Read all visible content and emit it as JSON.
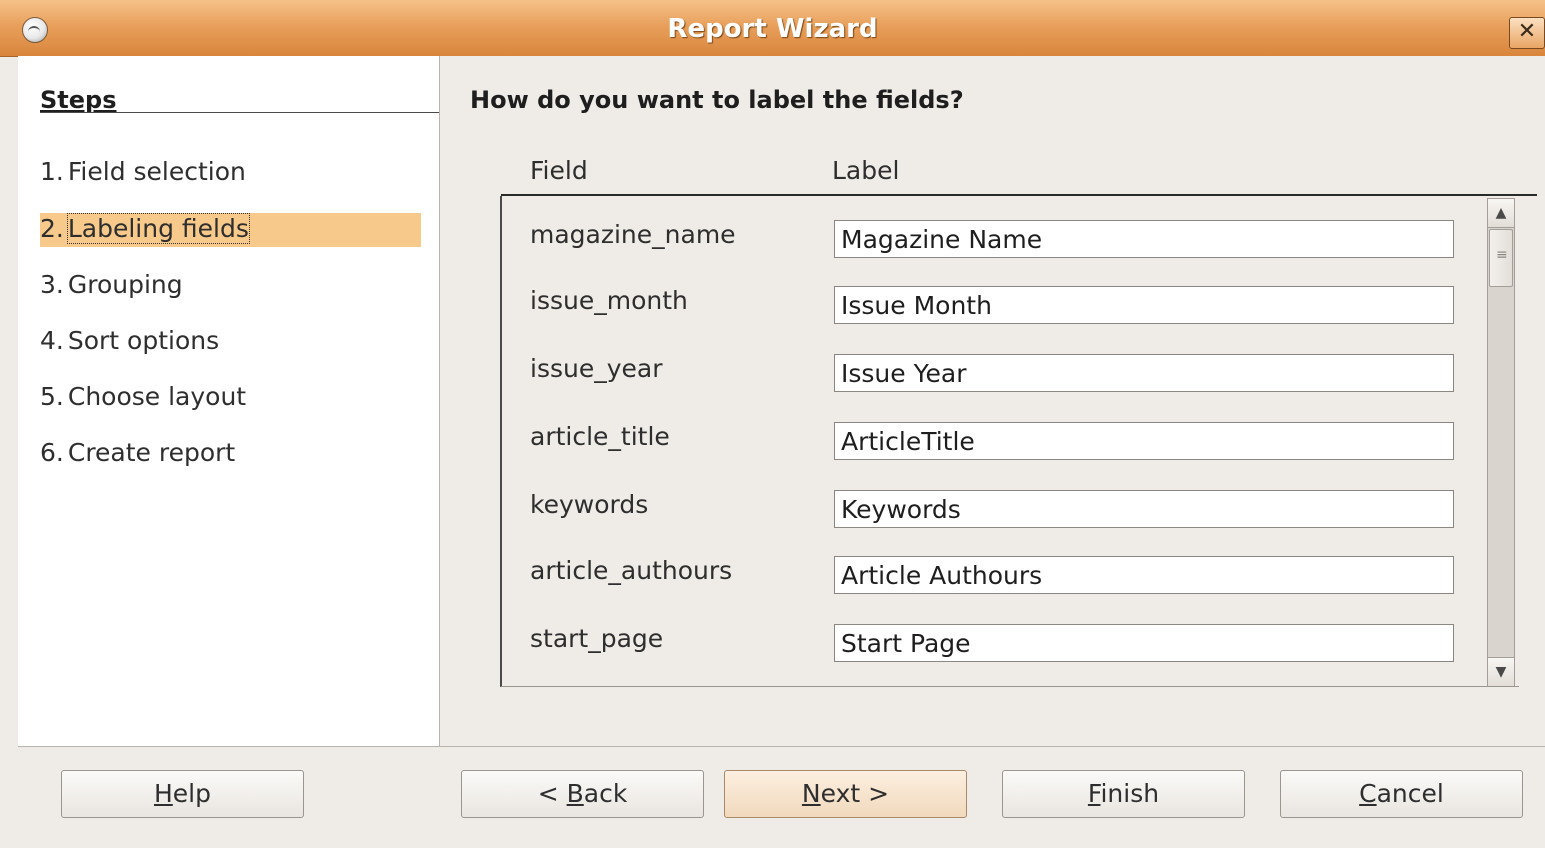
{
  "window": {
    "title": "Report Wizard",
    "close_glyph": "✕",
    "menu_icon": "window-menu-icon"
  },
  "steps": {
    "title": "Steps",
    "items": [
      {
        "num": "1.",
        "label": "Field selection",
        "selected": false
      },
      {
        "num": "2.",
        "label": "Labeling fields",
        "selected": true
      },
      {
        "num": "3.",
        "label": "Grouping",
        "selected": false
      },
      {
        "num": "4.",
        "label": "Sort options",
        "selected": false
      },
      {
        "num": "5.",
        "label": "Choose layout",
        "selected": false
      },
      {
        "num": "6.",
        "label": "Create report",
        "selected": false
      }
    ]
  },
  "main": {
    "question": "How do you want to label the fields?",
    "col_field": "Field",
    "col_label": "Label",
    "rows": [
      {
        "field": "magazine_name",
        "label": "Magazine Name"
      },
      {
        "field": "issue_month",
        "label": "Issue Month"
      },
      {
        "field": "issue_year",
        "label": "Issue Year"
      },
      {
        "field": "article_title",
        "label": "ArticleTitle"
      },
      {
        "field": "keywords",
        "label": "Keywords"
      },
      {
        "field": "article_authours",
        "label": "Article Authours"
      },
      {
        "field": "start_page",
        "label": "Start Page"
      }
    ]
  },
  "buttons": {
    "help": {
      "mnemonic": "H",
      "rest": "elp"
    },
    "back": {
      "prefix": "< ",
      "mnemonic": "B",
      "rest": "ack"
    },
    "next": {
      "mnemonic": "N",
      "rest": "ext >"
    },
    "finish": {
      "mnemonic": "F",
      "rest": "inish"
    },
    "cancel": {
      "mnemonic": "C",
      "rest": "ancel"
    }
  },
  "colors": {
    "accent": "#e8a05c",
    "selection": "#f7c98b"
  }
}
